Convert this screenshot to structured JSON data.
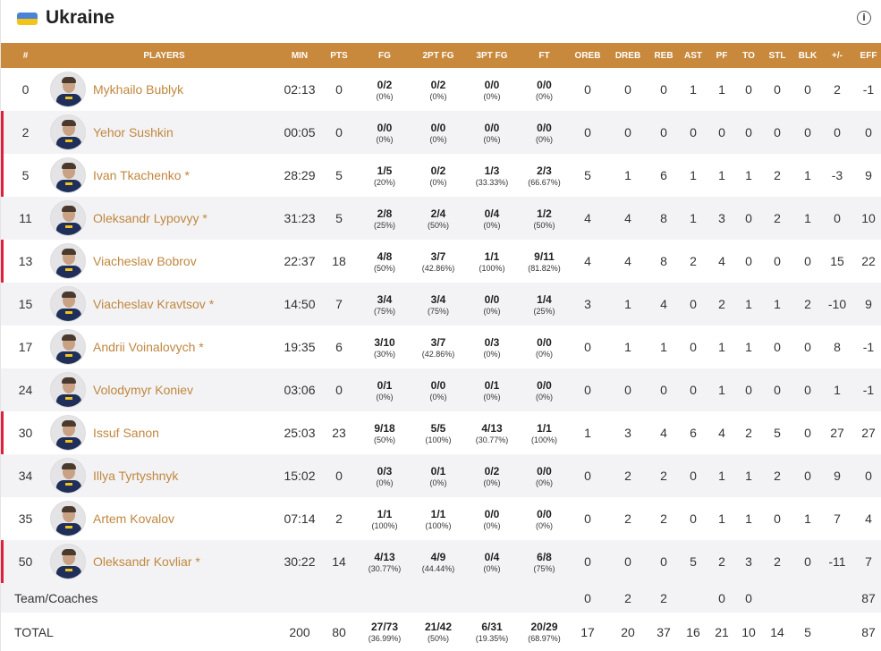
{
  "team": {
    "name": "Ukraine",
    "info_icon": "info-icon"
  },
  "colors": {
    "header_bg": "#c8893c",
    "player_name": "#c0873e",
    "on_court_marker": "#e01f3d",
    "flag_blue": "#4a82d8",
    "flag_yellow": "#f2c318"
  },
  "columns": [
    "#",
    "PLAYERS",
    "MIN",
    "PTS",
    "FG",
    "2PT FG",
    "3PT FG",
    "FT",
    "OREB",
    "DREB",
    "REB",
    "AST",
    "PF",
    "TO",
    "STL",
    "BLK",
    "+/-",
    "EFF"
  ],
  "players": [
    {
      "num": "0",
      "name": "Mykhailo Bublyk",
      "on_court": false,
      "min": "02:13",
      "pts": "0",
      "fg": "0/2",
      "fg_pct": "(0%)",
      "fg2": "0/2",
      "fg2_pct": "(0%)",
      "fg3": "0/0",
      "fg3_pct": "(0%)",
      "ft": "0/0",
      "ft_pct": "(0%)",
      "oreb": "0",
      "dreb": "0",
      "reb": "0",
      "ast": "1",
      "pf": "1",
      "to": "0",
      "stl": "0",
      "blk": "0",
      "pm": "2",
      "eff": "-1"
    },
    {
      "num": "2",
      "name": "Yehor Sushkin",
      "on_court": true,
      "min": "00:05",
      "pts": "0",
      "fg": "0/0",
      "fg_pct": "(0%)",
      "fg2": "0/0",
      "fg2_pct": "(0%)",
      "fg3": "0/0",
      "fg3_pct": "(0%)",
      "ft": "0/0",
      "ft_pct": "(0%)",
      "oreb": "0",
      "dreb": "0",
      "reb": "0",
      "ast": "0",
      "pf": "0",
      "to": "0",
      "stl": "0",
      "blk": "0",
      "pm": "0",
      "eff": "0"
    },
    {
      "num": "5",
      "name": "Ivan Tkachenko *",
      "on_court": true,
      "min": "28:29",
      "pts": "5",
      "fg": "1/5",
      "fg_pct": "(20%)",
      "fg2": "0/2",
      "fg2_pct": "(0%)",
      "fg3": "1/3",
      "fg3_pct": "(33.33%)",
      "ft": "2/3",
      "ft_pct": "(66.67%)",
      "oreb": "5",
      "dreb": "1",
      "reb": "6",
      "ast": "1",
      "pf": "1",
      "to": "1",
      "stl": "2",
      "blk": "1",
      "pm": "-3",
      "eff": "9"
    },
    {
      "num": "11",
      "name": "Oleksandr Lypovyy *",
      "on_court": false,
      "min": "31:23",
      "pts": "5",
      "fg": "2/8",
      "fg_pct": "(25%)",
      "fg2": "2/4",
      "fg2_pct": "(50%)",
      "fg3": "0/4",
      "fg3_pct": "(0%)",
      "ft": "1/2",
      "ft_pct": "(50%)",
      "oreb": "4",
      "dreb": "4",
      "reb": "8",
      "ast": "1",
      "pf": "3",
      "to": "0",
      "stl": "2",
      "blk": "1",
      "pm": "0",
      "eff": "10"
    },
    {
      "num": "13",
      "name": "Viacheslav Bobrov",
      "on_court": true,
      "min": "22:37",
      "pts": "18",
      "fg": "4/8",
      "fg_pct": "(50%)",
      "fg2": "3/7",
      "fg2_pct": "(42.86%)",
      "fg3": "1/1",
      "fg3_pct": "(100%)",
      "ft": "9/11",
      "ft_pct": "(81.82%)",
      "oreb": "4",
      "dreb": "4",
      "reb": "8",
      "ast": "2",
      "pf": "4",
      "to": "0",
      "stl": "0",
      "blk": "0",
      "pm": "15",
      "eff": "22"
    },
    {
      "num": "15",
      "name": "Viacheslav Kravtsov *",
      "on_court": false,
      "min": "14:50",
      "pts": "7",
      "fg": "3/4",
      "fg_pct": "(75%)",
      "fg2": "3/4",
      "fg2_pct": "(75%)",
      "fg3": "0/0",
      "fg3_pct": "(0%)",
      "ft": "1/4",
      "ft_pct": "(25%)",
      "oreb": "3",
      "dreb": "1",
      "reb": "4",
      "ast": "0",
      "pf": "2",
      "to": "1",
      "stl": "1",
      "blk": "2",
      "pm": "-10",
      "eff": "9"
    },
    {
      "num": "17",
      "name": "Andrii Voinalovych *",
      "on_court": false,
      "min": "19:35",
      "pts": "6",
      "fg": "3/10",
      "fg_pct": "(30%)",
      "fg2": "3/7",
      "fg2_pct": "(42.86%)",
      "fg3": "0/3",
      "fg3_pct": "(0%)",
      "ft": "0/0",
      "ft_pct": "(0%)",
      "oreb": "0",
      "dreb": "1",
      "reb": "1",
      "ast": "0",
      "pf": "1",
      "to": "1",
      "stl": "0",
      "blk": "0",
      "pm": "8",
      "eff": "-1"
    },
    {
      "num": "24",
      "name": "Volodymyr Koniev",
      "on_court": false,
      "min": "03:06",
      "pts": "0",
      "fg": "0/1",
      "fg_pct": "(0%)",
      "fg2": "0/0",
      "fg2_pct": "(0%)",
      "fg3": "0/1",
      "fg3_pct": "(0%)",
      "ft": "0/0",
      "ft_pct": "(0%)",
      "oreb": "0",
      "dreb": "0",
      "reb": "0",
      "ast": "0",
      "pf": "1",
      "to": "0",
      "stl": "0",
      "blk": "0",
      "pm": "1",
      "eff": "-1"
    },
    {
      "num": "30",
      "name": "Issuf Sanon",
      "on_court": true,
      "min": "25:03",
      "pts": "23",
      "fg": "9/18",
      "fg_pct": "(50%)",
      "fg2": "5/5",
      "fg2_pct": "(100%)",
      "fg3": "4/13",
      "fg3_pct": "(30.77%)",
      "ft": "1/1",
      "ft_pct": "(100%)",
      "oreb": "1",
      "dreb": "3",
      "reb": "4",
      "ast": "6",
      "pf": "4",
      "to": "2",
      "stl": "5",
      "blk": "0",
      "pm": "27",
      "eff": "27"
    },
    {
      "num": "34",
      "name": "Illya Tyrtyshnyk",
      "on_court": false,
      "min": "15:02",
      "pts": "0",
      "fg": "0/3",
      "fg_pct": "(0%)",
      "fg2": "0/1",
      "fg2_pct": "(0%)",
      "fg3": "0/2",
      "fg3_pct": "(0%)",
      "ft": "0/0",
      "ft_pct": "(0%)",
      "oreb": "0",
      "dreb": "2",
      "reb": "2",
      "ast": "0",
      "pf": "1",
      "to": "1",
      "stl": "2",
      "blk": "0",
      "pm": "9",
      "eff": "0"
    },
    {
      "num": "35",
      "name": "Artem Kovalov",
      "on_court": false,
      "min": "07:14",
      "pts": "2",
      "fg": "1/1",
      "fg_pct": "(100%)",
      "fg2": "1/1",
      "fg2_pct": "(100%)",
      "fg3": "0/0",
      "fg3_pct": "(0%)",
      "ft": "0/0",
      "ft_pct": "(0%)",
      "oreb": "0",
      "dreb": "2",
      "reb": "2",
      "ast": "0",
      "pf": "1",
      "to": "1",
      "stl": "0",
      "blk": "1",
      "pm": "7",
      "eff": "4"
    },
    {
      "num": "50",
      "name": "Oleksandr Kovliar *",
      "on_court": true,
      "min": "30:22",
      "pts": "14",
      "fg": "4/13",
      "fg_pct": "(30.77%)",
      "fg2": "4/9",
      "fg2_pct": "(44.44%)",
      "fg3": "0/4",
      "fg3_pct": "(0%)",
      "ft": "6/8",
      "ft_pct": "(75%)",
      "oreb": "0",
      "dreb": "0",
      "reb": "0",
      "ast": "5",
      "pf": "2",
      "to": "3",
      "stl": "2",
      "blk": "0",
      "pm": "-11",
      "eff": "7"
    }
  ],
  "team_coaches": {
    "label": "Team/Coaches",
    "oreb": "0",
    "dreb": "2",
    "reb": "2",
    "pf": "0",
    "to": "0",
    "eff": "87"
  },
  "total": {
    "label": "TOTAL",
    "min": "200",
    "pts": "80",
    "fg": "27/73",
    "fg_pct": "(36.99%)",
    "fg2": "21/42",
    "fg2_pct": "(50%)",
    "fg3": "6/31",
    "fg3_pct": "(19.35%)",
    "ft": "20/29",
    "ft_pct": "(68.97%)",
    "oreb": "17",
    "dreb": "20",
    "reb": "37",
    "ast": "16",
    "pf": "21",
    "to": "10",
    "stl": "14",
    "blk": "5",
    "eff": "87"
  }
}
